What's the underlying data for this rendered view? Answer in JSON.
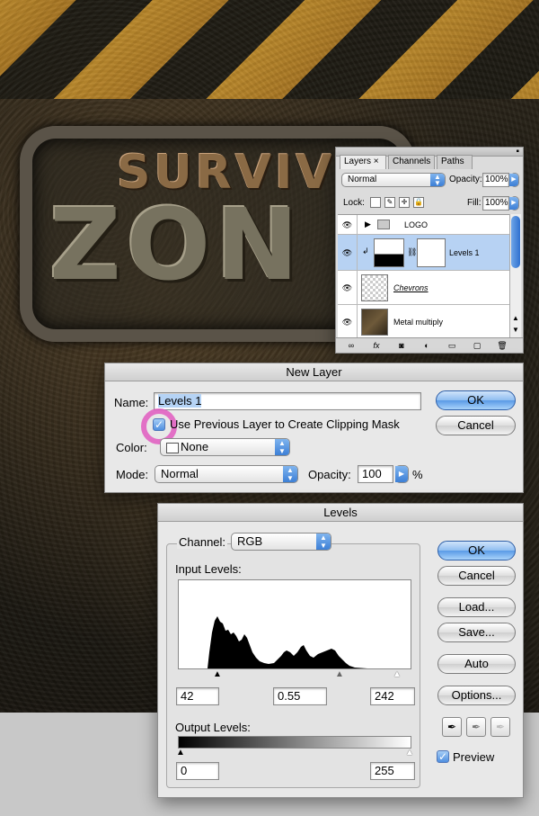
{
  "artwork": {
    "logo_top": "SURVIV",
    "logo_main": "ZON"
  },
  "layers_panel": {
    "tabs": [
      "Layers",
      "Channels",
      "Paths"
    ],
    "tab_close": "×",
    "blend_mode": "Normal",
    "opacity_label": "Opacity:",
    "opacity_value": "100%",
    "lock_label": "Lock:",
    "fill_label": "Fill:",
    "fill_value": "100%",
    "layers": [
      {
        "name": "LOGO",
        "type": "group"
      },
      {
        "name": "Levels 1",
        "type": "adjustment",
        "selected": true
      },
      {
        "name": "Chevrons",
        "type": "layer"
      },
      {
        "name": "Metal multiply",
        "type": "layer"
      }
    ],
    "footer_icons": [
      "link-icon",
      "fx-icon",
      "mask-icon",
      "adjustment-icon",
      "folder-icon",
      "new-layer-icon",
      "trash-icon"
    ]
  },
  "new_layer_dialog": {
    "title": "New Layer",
    "name_label": "Name:",
    "name_value": "Levels 1",
    "clip_label": "Use Previous Layer to Create Clipping Mask",
    "color_label": "Color:",
    "color_value": "None",
    "mode_label": "Mode:",
    "mode_value": "Normal",
    "opacity_label": "Opacity:",
    "opacity_value": "100",
    "opacity_unit": "%",
    "ok": "OK",
    "cancel": "Cancel"
  },
  "levels_dialog": {
    "title": "Levels",
    "channel_label": "Channel:",
    "channel_value": "RGB",
    "input_label": "Input Levels:",
    "input_black": "42",
    "input_gamma": "0.55",
    "input_white": "242",
    "output_label": "Output Levels:",
    "output_black": "0",
    "output_white": "255",
    "buttons": {
      "ok": "OK",
      "cancel": "Cancel",
      "load": "Load...",
      "save": "Save...",
      "auto": "Auto",
      "options": "Options..."
    },
    "preview_label": "Preview",
    "preview_checked": true
  },
  "colors": {
    "accent": "#3c7fd6",
    "highlight_ring": "#e05bbf",
    "selected_row": "#b7d2f3"
  }
}
